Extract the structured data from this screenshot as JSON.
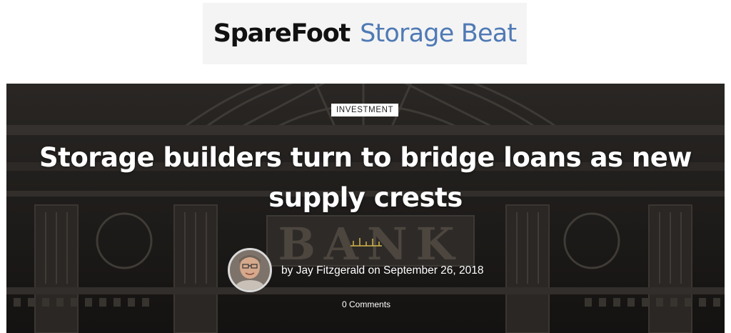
{
  "header": {
    "logo_brand": "SpareFoot",
    "logo_sub": "Storage Beat",
    "logo_brand_color": "#111111",
    "logo_sub_color": "#4f7ab4"
  },
  "hero": {
    "background_image": "bank-building-facade",
    "background_text": "BANK",
    "category": "INVESTMENT",
    "title_line1": "Storage builders turn to bridge loans as new",
    "title_line2": "supply crests",
    "divider_icon": "ruler-divider-icon",
    "divider_color": "#d4b64a",
    "author_prefix": "by",
    "author": "Jay Fitzgerald",
    "date_prefix": "on",
    "date": "September 26, 2018",
    "comments": "0 Comments"
  }
}
